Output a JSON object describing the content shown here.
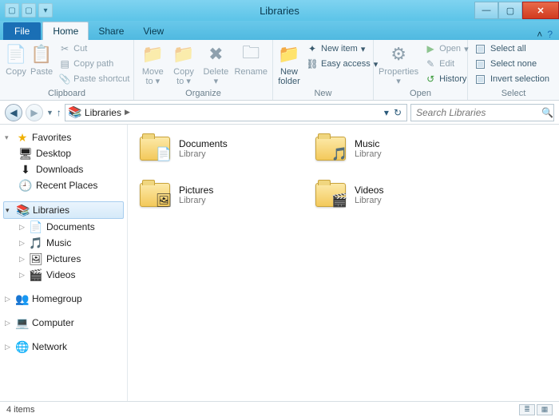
{
  "window": {
    "title": "Libraries"
  },
  "tabs": {
    "file": "File",
    "home": "Home",
    "share": "Share",
    "view": "View"
  },
  "ribbon": {
    "clipboard": {
      "label": "Clipboard",
      "copy": "Copy",
      "paste": "Paste",
      "cut": "Cut",
      "copy_path": "Copy path",
      "paste_shortcut": "Paste shortcut"
    },
    "organize": {
      "label": "Organize",
      "move_to": "Move to",
      "copy_to": "Copy to",
      "delete": "Delete",
      "rename": "Rename"
    },
    "new": {
      "label": "New",
      "new_folder": "New folder",
      "new_item": "New item",
      "easy_access": "Easy access"
    },
    "open": {
      "label": "Open",
      "properties": "Properties",
      "open": "Open",
      "edit": "Edit",
      "history": "History"
    },
    "select": {
      "label": "Select",
      "select_all": "Select all",
      "select_none": "Select none",
      "invert": "Invert selection"
    }
  },
  "address": {
    "crumb": "Libraries"
  },
  "search": {
    "placeholder": "Search Libraries"
  },
  "nav": {
    "favorites": {
      "label": "Favorites",
      "desktop": "Desktop",
      "downloads": "Downloads",
      "recent": "Recent Places"
    },
    "libraries": {
      "label": "Libraries",
      "documents": "Documents",
      "music": "Music",
      "pictures": "Pictures",
      "videos": "Videos"
    },
    "homegroup": "Homegroup",
    "computer": "Computer",
    "network": "Network"
  },
  "items": {
    "sub": "Library",
    "documents": "Documents",
    "music": "Music",
    "pictures": "Pictures",
    "videos": "Videos"
  },
  "status": {
    "count": "4 items"
  }
}
